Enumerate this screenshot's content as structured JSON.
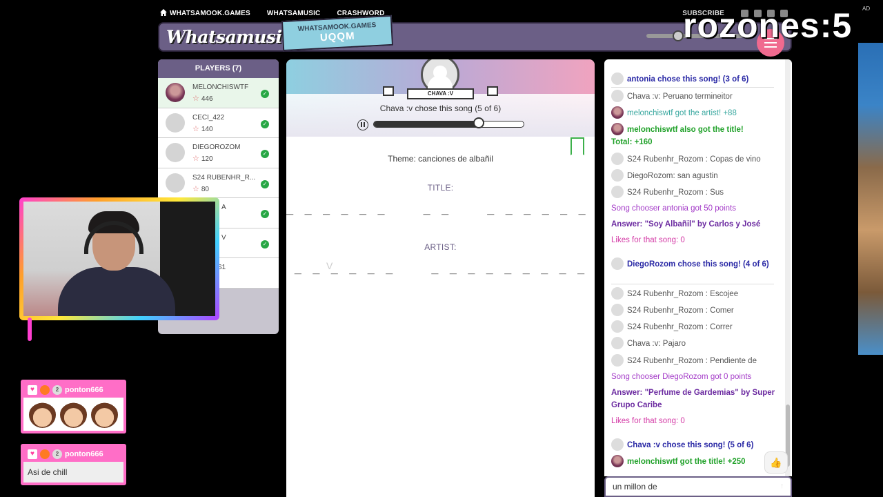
{
  "nav": {
    "links": [
      "WHATSAMOOK.GAMES",
      "WHATSAMUSIC",
      "CRASHWORD"
    ],
    "subscribe": "SUBSCRIBE",
    "ad": "AD"
  },
  "header": {
    "logo": "Whatsamusic",
    "room_site": "WHATSAMOOK.GAMES",
    "room_code": "UQQM"
  },
  "overlay": {
    "score_text": "rozones:5"
  },
  "players": {
    "title": "PLAYERS (7)",
    "items": [
      {
        "name": "MELONCHISWTF",
        "score": "446"
      },
      {
        "name": "CECI_422",
        "score": "140"
      },
      {
        "name": "DIEGOROZOM",
        "score": "120"
      },
      {
        "name": "S24 RUBENHR_R...",
        "score": "80"
      },
      {
        "name": "A",
        "score": ""
      },
      {
        "name": "V",
        "score": ""
      },
      {
        "name": "S1",
        "score": ""
      }
    ]
  },
  "alerts": [
    {
      "user": "ponton666",
      "badge": "2"
    },
    {
      "user": "ponton666",
      "badge": "2",
      "message": "Asi de chill"
    }
  ],
  "game": {
    "chooser_name": "CHAVA :V",
    "chose_text": "Chava :v chose this song (5 of 6)",
    "progress": 0.7,
    "theme": "Theme: canciones de albañil",
    "title_label": "TITLE:",
    "title_blanks": "_ _ _ _ _ _    _ _    _ _ _ _ _ _ _ _ _ _",
    "artist_label": "ARTIST:",
    "artist_blanks": "_ _ _ _ _ _    _ _ _ _ _ _ _ _ _",
    "artist_ghost": "V"
  },
  "chat": {
    "lines": [
      {
        "text": "antonia chose this song! (3 of 6)"
      },
      {
        "text": "Chava :v: Peruano termineitor"
      },
      {
        "text": "melonchiswtf got the artist! +88"
      },
      {
        "text": "melonchiswtf also got the title!"
      },
      {
        "text": "Total: +160"
      },
      {
        "text": "S24 Rubenhr_Rozom : Copas de vino"
      },
      {
        "text": "DiegoRozom: san agustin"
      },
      {
        "text": "S24 Rubenhr_Rozom : Sus"
      },
      {
        "text": "Song chooser antonia got 50 points"
      },
      {
        "text": "Answer: \"Soy Albañil\" by Carlos y José"
      },
      {
        "text": "Likes for that song: 0"
      },
      {
        "text": "DiegoRozom chose this song! (4 of 6)"
      },
      {
        "text": "S24 Rubenhr_Rozom : Escojee"
      },
      {
        "text": "S24 Rubenhr_Rozom : Comer"
      },
      {
        "text": "S24 Rubenhr_Rozom : Correr"
      },
      {
        "text": "Chava :v: Pajaro"
      },
      {
        "text": "S24 Rubenhr_Rozom : Pendiente de"
      },
      {
        "text": "Song chooser DiegoRozom got 0 points"
      },
      {
        "text": "Answer: \"Perfume de Gardemias\" by Super Grupo Caribe"
      },
      {
        "text": "Likes for that song: 0"
      },
      {
        "text": "Chava :v chose this song! (5 of 6)"
      },
      {
        "text": "melonchiswtf got the title! +250"
      }
    ],
    "input_value": "un millon de"
  }
}
